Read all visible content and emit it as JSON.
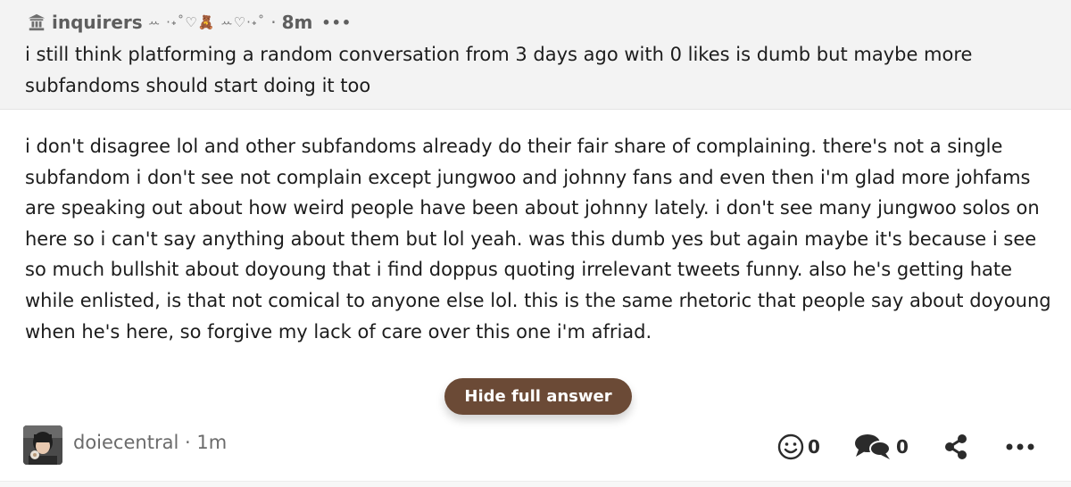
{
  "question": {
    "asker": "inquirers",
    "decoration": "ꕀ ·˖˚♡🧸 ꕀ♡·˖˚",
    "separator": "·",
    "time": "8m",
    "more": "•••",
    "text": "i still think platforming a random conversation from 3 days ago with 0 likes is dumb but maybe more subfandoms should start doing it too"
  },
  "answer": {
    "text": "i don't disagree lol and other subfandoms already do their fair share of complaining. there's not a single subfandom i don't see not complain except jungwoo and johnny fans and even then i'm glad more johfams are speaking out about how weird people have been about johnny lately. i don't see many jungwoo solos on here so i can't say anything about them but lol yeah. was this dumb yes but again maybe it's because i see so much bullshit about doyoung that i find doppus quoting irrelevant tweets funny. also he's getting hate while enlisted, is that not comical to anyone else lol. this is the same rhetoric that people say about doyoung when he's here, so forgive my lack of care over this one i'm afriad.",
    "toggle_label": "Hide full answer"
  },
  "footer": {
    "username": "doiecentral",
    "separator": "·",
    "time": "1m",
    "reaction_count": "0",
    "comment_count": "0"
  },
  "icons": {
    "asker": "pavilion-user-icon",
    "reaction": "smiley-icon",
    "comment": "speech-bubbles-icon",
    "share": "share-icon",
    "more": "more-dots-icon"
  },
  "colors": {
    "button": "#6b4a36",
    "question_bg": "#f3f3f3",
    "muted_text": "#6b6b6b"
  }
}
